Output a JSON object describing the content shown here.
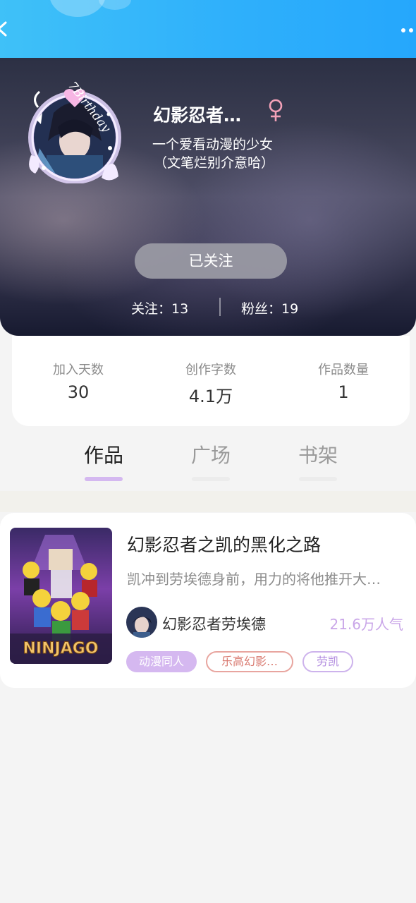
{
  "profile": {
    "avatar_caption": "7Birthday",
    "nickname": "幻影忍者…",
    "gender_symbol": "♀",
    "bio_line1": "一个爱看动漫的少女",
    "bio_line2": "（文笔烂别介意哈）",
    "follow_button": "已关注",
    "following_text": "关注：13",
    "fans_text": "粉丝：19"
  },
  "stats": [
    {
      "label": "加入天数",
      "value": "30"
    },
    {
      "label": "创作字数",
      "value": "4.1万"
    },
    {
      "label": "作品数量",
      "value": "1"
    }
  ],
  "tabs": [
    {
      "label": "作品",
      "active": true
    },
    {
      "label": "广场",
      "active": false
    },
    {
      "label": "书架",
      "active": false
    }
  ],
  "work": {
    "cover_text": "NINJAGO",
    "title": "幻影忍者之凯的黑化之路",
    "excerpt": "凯冲到劳埃德身前，用力的将他推开大…",
    "author": "幻影忍者劳埃德",
    "popularity": "21.6万人气",
    "tags": [
      "动漫同人",
      "乐高幻影…",
      "劳凯"
    ]
  },
  "colors": {
    "topbar": "#2fb0fb",
    "accent_purple": "#c9a6e8",
    "tab_indicator": "#d4b8f0",
    "gender_pink": "#f3a1b8"
  }
}
